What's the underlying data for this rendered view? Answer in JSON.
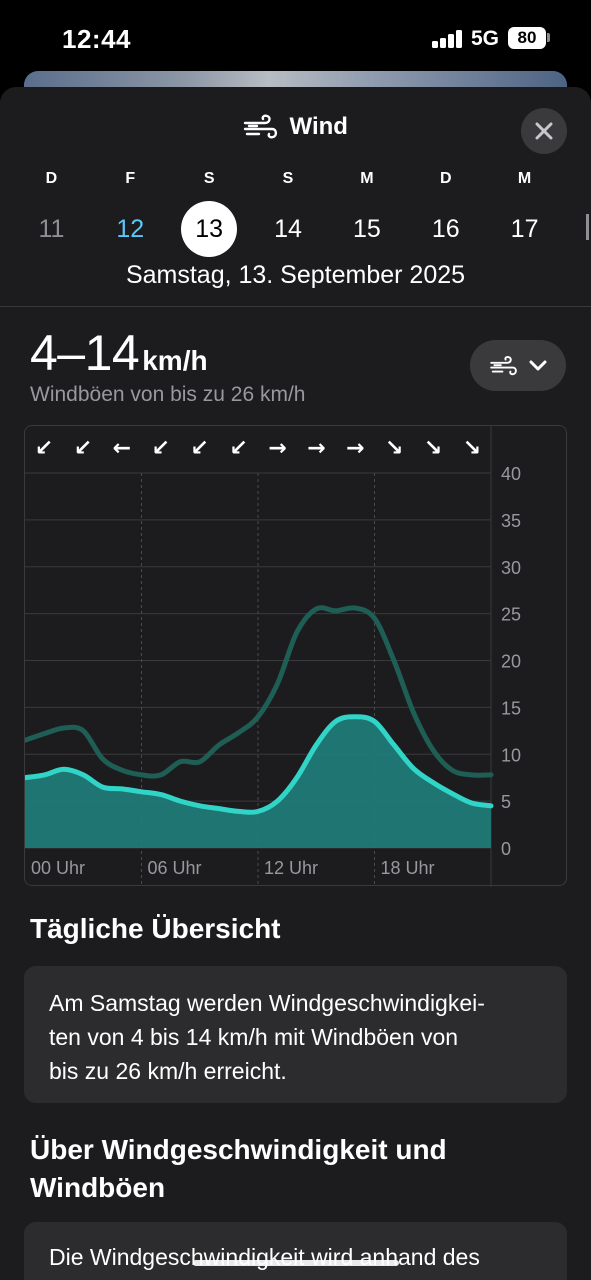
{
  "status_bar": {
    "time": "12:44",
    "network": "5G",
    "battery": "80"
  },
  "header": {
    "title": "Wind",
    "icon": "wind-icon",
    "close_icon": "close-icon"
  },
  "calendar": {
    "weekdays": [
      "D",
      "F",
      "S",
      "S",
      "M",
      "D",
      "M"
    ],
    "dates": [
      "11",
      "12",
      "13",
      "14",
      "15",
      "16",
      "17"
    ],
    "selected_index": 2,
    "today_index": 1,
    "full_date": "Samstag, 13. September 2025"
  },
  "summary": {
    "range": "4–14",
    "unit": "km/h",
    "gusts": "Windböen von bis zu 26 km/h",
    "picker_icon": "wind-icon",
    "picker_chevron": "chevron-down-icon"
  },
  "chart_data": {
    "type": "area",
    "x_labels": [
      "00 Uhr",
      "06 Uhr",
      "12 Uhr",
      "18 Uhr"
    ],
    "y_ticks": [
      "0",
      "5",
      "10",
      "15",
      "20",
      "25",
      "30",
      "35",
      "40"
    ],
    "ylim": [
      0,
      40
    ],
    "xlim": [
      0,
      24
    ],
    "grid": true,
    "direction_arrows": [
      "↙",
      "↙",
      "←",
      "↙",
      "↙",
      "↙",
      "→",
      "→",
      "→",
      "↘",
      "↘",
      "↘"
    ],
    "colors": {
      "wind": "#30d5c8",
      "wind_fill": "#1f7f7a",
      "gusts": "#1e5e55"
    },
    "series": [
      {
        "x": [
          0,
          1,
          2,
          3,
          4,
          5,
          6,
          7,
          8,
          9,
          10,
          11,
          12,
          13,
          14,
          15,
          16,
          17,
          18,
          19,
          20,
          21,
          22,
          23,
          24
        ],
        "values": [
          7.5,
          7.8,
          8.4,
          7.8,
          6.5,
          6.3,
          6.0,
          5.7,
          5.0,
          4.5,
          4.2,
          3.9,
          3.9,
          5.0,
          7.5,
          11.0,
          13.5,
          14.0,
          13.5,
          11.0,
          8.5,
          7.0,
          5.8,
          4.8,
          4.5
        ]
      },
      {
        "x": [
          0,
          1,
          2,
          3,
          4,
          5,
          6,
          7,
          8,
          9,
          10,
          11,
          12,
          13,
          14,
          15,
          16,
          17,
          18,
          19,
          20,
          21,
          22,
          23,
          24
        ],
        "values": [
          11.5,
          12.2,
          12.8,
          12.5,
          9.5,
          8.3,
          7.8,
          7.8,
          9.2,
          9.2,
          11.0,
          12.3,
          14.0,
          17.5,
          23.0,
          25.5,
          25.3,
          25.6,
          24.5,
          20.0,
          14.5,
          10.5,
          8.3,
          7.8,
          7.8
        ]
      }
    ]
  },
  "daily_overview": {
    "title": "Tägliche Übersicht",
    "line1": "Am Samstag werden Windgeschwindigkei-",
    "line2": "ten von 4 bis 14 km/h mit Windböen von",
    "line3": "bis zu 26 km/h erreicht."
  },
  "about": {
    "title_line1": "Über Windgeschwindigkeit und",
    "title_line2": "Windböen",
    "text": "Die Windgeschwindigkeit wird anhand des"
  }
}
